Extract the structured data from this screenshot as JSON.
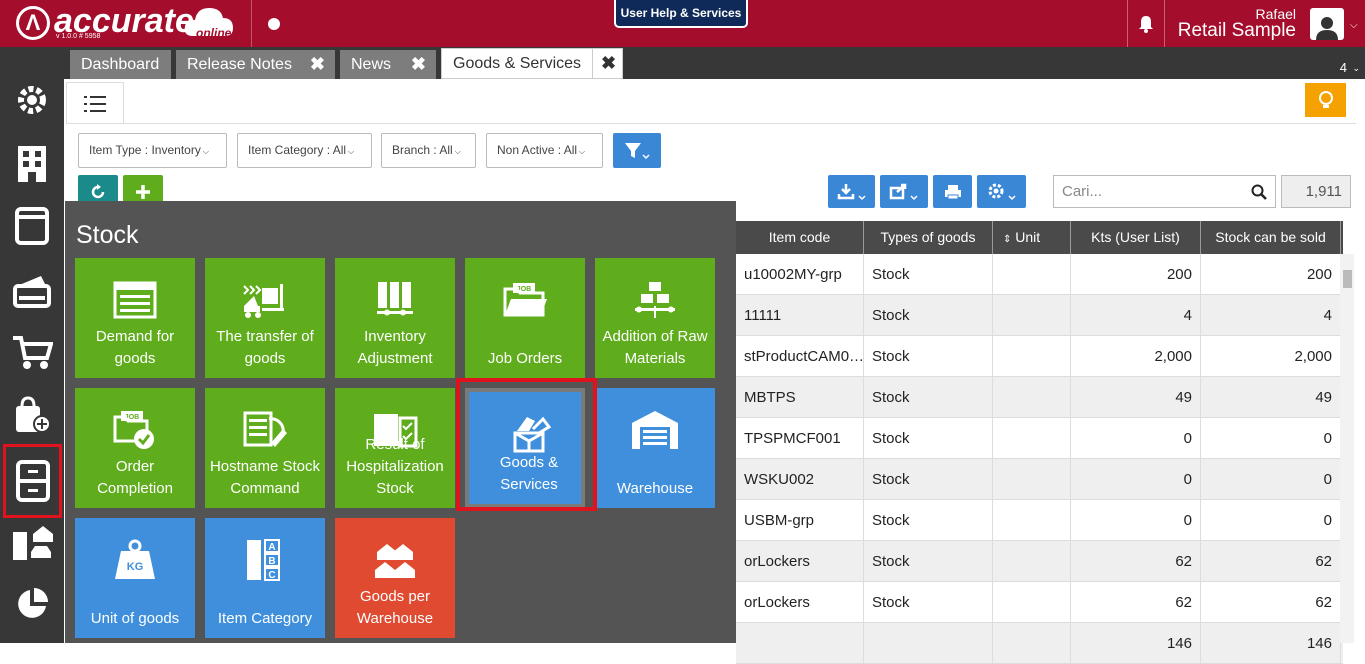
{
  "app": {
    "logo_text": "accurate",
    "logo_sub": "online",
    "version": "v 1.0.0 # 5958",
    "help_label": "User Help & Services",
    "user_name": "Rafael",
    "company": "Retail Sample",
    "brand_color": "#a50d2c"
  },
  "tabs": [
    {
      "label": "Dashboard",
      "closable": false
    },
    {
      "label": "Release Notes",
      "closable": true
    },
    {
      "label": "News",
      "closable": true
    },
    {
      "label": "Goods & Services",
      "closable": true,
      "active": true
    }
  ],
  "tab_count": "4",
  "sidebar": [
    {
      "icon": "settings-gear-icon"
    },
    {
      "icon": "building-icon"
    },
    {
      "icon": "ledger-book-icon"
    },
    {
      "icon": "wallet-icon"
    },
    {
      "icon": "shopping-cart-icon"
    },
    {
      "icon": "bag-add-icon"
    },
    {
      "icon": "cabinet-icon",
      "active": true
    },
    {
      "icon": "company-assets-icon"
    },
    {
      "icon": "pie-chart-icon"
    }
  ],
  "filters": {
    "item_type": "Item Type : Inventory",
    "item_category": "Item Category : All",
    "branch": "Branch : All",
    "non_active": "Non Active : All"
  },
  "search": {
    "placeholder": "Cari..."
  },
  "total_count": "1,911",
  "table": {
    "headers": [
      "Item code",
      "Types of goods",
      "Unit",
      "Kts (User List)",
      "Stock can be sold"
    ],
    "rows": [
      [
        "u10002MY-grp",
        "Stock",
        "",
        "200",
        "200"
      ],
      [
        "11111",
        "Stock",
        "",
        "4",
        "4"
      ],
      [
        "stProductCAM0…",
        "Stock",
        "",
        "2,000",
        "2,000"
      ],
      [
        "MBTPS",
        "Stock",
        "",
        "49",
        "49"
      ],
      [
        "TPSPMCF001",
        "Stock",
        "",
        "0",
        "0"
      ],
      [
        "WSKU002",
        "Stock",
        "",
        "0",
        "0"
      ],
      [
        "USBM-grp",
        "Stock",
        "",
        "0",
        "0"
      ],
      [
        "orLockers",
        "Stock",
        "",
        "62",
        "62"
      ],
      [
        "orLockers",
        "Stock",
        "",
        "62",
        "62"
      ],
      [
        "",
        "",
        "",
        "146",
        "146"
      ]
    ]
  },
  "menu": {
    "title": "Stock",
    "tiles": [
      {
        "label": "Demand for goods",
        "icon": "demand-form-icon",
        "color": "green"
      },
      {
        "label": "The transfer of goods",
        "icon": "forklift-icon",
        "color": "green"
      },
      {
        "label": "Inventory Adjustment",
        "icon": "adjustment-icon",
        "color": "green"
      },
      {
        "label": "Job Orders",
        "icon": "job-folder-icon",
        "color": "green"
      },
      {
        "label": "Addition of Raw Materials",
        "icon": "raw-materials-icon",
        "color": "green"
      },
      {
        "label": "Order Completion",
        "icon": "order-check-icon",
        "color": "green"
      },
      {
        "label": "Hostname Stock Command",
        "icon": "stock-command-icon",
        "color": "green"
      },
      {
        "label": "Result of Hospitalization Stock",
        "icon": "stock-result-icon",
        "color": "green"
      },
      {
        "label": "Goods & Services",
        "icon": "goods-box-icon",
        "color": "blue",
        "selected": true
      },
      {
        "label": "Warehouse",
        "icon": "warehouse-icon",
        "color": "blue"
      },
      {
        "label": "Unit of goods",
        "icon": "weight-kg-icon",
        "color": "blue"
      },
      {
        "label": "Item Category",
        "icon": "abc-list-icon",
        "color": "blue"
      },
      {
        "label": "Goods per Warehouse",
        "icon": "goods-warehouse-icon",
        "color": "red"
      }
    ],
    "kg_label": "KG",
    "job_label": "JOB"
  }
}
